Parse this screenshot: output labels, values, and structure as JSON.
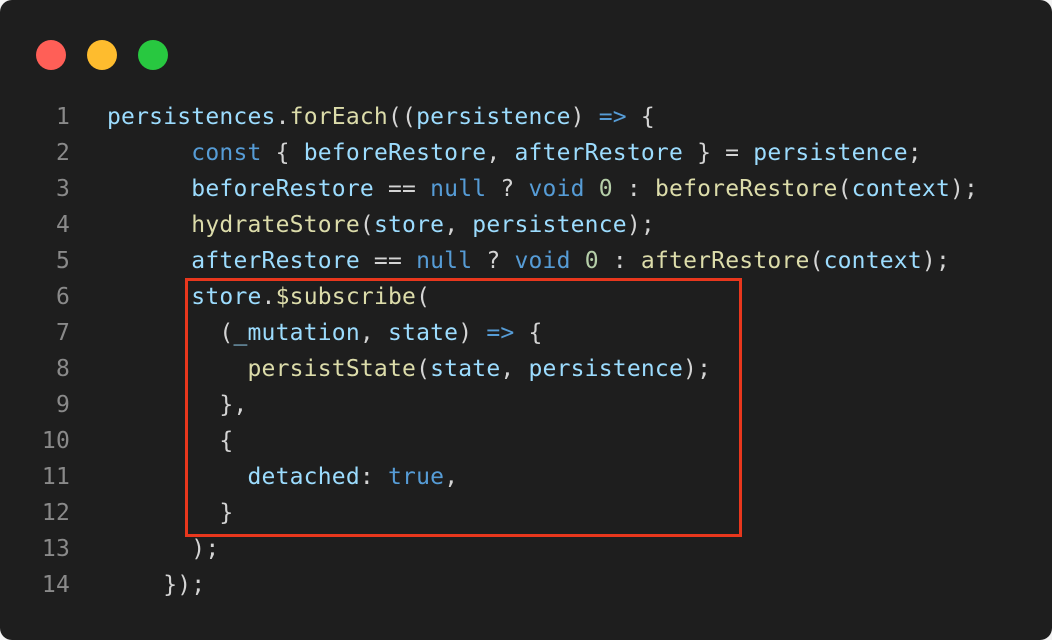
{
  "window": {
    "controls": [
      {
        "name": "close",
        "color": "#ff5f57"
      },
      {
        "name": "minimize",
        "color": "#febc2e"
      },
      {
        "name": "zoom",
        "color": "#28c840"
      }
    ]
  },
  "colors": {
    "background": "#1e1e1e",
    "line_number": "#8a8a8a",
    "highlight_border": "#e8371d",
    "variable": "#9cdcfe",
    "keyword": "#569cd6",
    "function": "#dcdcaa",
    "number": "#b5cea8",
    "punctuation": "#d4d4d4"
  },
  "highlight": {
    "from_line": 6,
    "to_line": 12
  },
  "lines": [
    {
      "number": "1",
      "tokens": [
        {
          "t": "persistences",
          "c": "variable"
        },
        {
          "t": ".",
          "c": "punctuation"
        },
        {
          "t": "forEach",
          "c": "function"
        },
        {
          "t": "((",
          "c": "punctuation"
        },
        {
          "t": "persistence",
          "c": "variable"
        },
        {
          "t": ") ",
          "c": "punctuation"
        },
        {
          "t": "=>",
          "c": "keyword"
        },
        {
          "t": " {",
          "c": "punctuation"
        }
      ]
    },
    {
      "number": "2",
      "tokens": [
        {
          "t": "      ",
          "c": "punctuation"
        },
        {
          "t": "const",
          "c": "keyword"
        },
        {
          "t": " { ",
          "c": "punctuation"
        },
        {
          "t": "beforeRestore",
          "c": "variable"
        },
        {
          "t": ", ",
          "c": "punctuation"
        },
        {
          "t": "afterRestore",
          "c": "variable"
        },
        {
          "t": " } = ",
          "c": "punctuation"
        },
        {
          "t": "persistence",
          "c": "variable"
        },
        {
          "t": ";",
          "c": "punctuation"
        }
      ]
    },
    {
      "number": "3",
      "tokens": [
        {
          "t": "      ",
          "c": "punctuation"
        },
        {
          "t": "beforeRestore",
          "c": "variable"
        },
        {
          "t": " == ",
          "c": "punctuation"
        },
        {
          "t": "null",
          "c": "keyword"
        },
        {
          "t": " ? ",
          "c": "punctuation"
        },
        {
          "t": "void",
          "c": "keyword"
        },
        {
          "t": " ",
          "c": "punctuation"
        },
        {
          "t": "0",
          "c": "number"
        },
        {
          "t": " : ",
          "c": "punctuation"
        },
        {
          "t": "beforeRestore",
          "c": "function"
        },
        {
          "t": "(",
          "c": "punctuation"
        },
        {
          "t": "context",
          "c": "variable"
        },
        {
          "t": ");",
          "c": "punctuation"
        }
      ]
    },
    {
      "number": "4",
      "tokens": [
        {
          "t": "      ",
          "c": "punctuation"
        },
        {
          "t": "hydrateStore",
          "c": "function"
        },
        {
          "t": "(",
          "c": "punctuation"
        },
        {
          "t": "store",
          "c": "variable"
        },
        {
          "t": ", ",
          "c": "punctuation"
        },
        {
          "t": "persistence",
          "c": "variable"
        },
        {
          "t": ");",
          "c": "punctuation"
        }
      ]
    },
    {
      "number": "5",
      "tokens": [
        {
          "t": "      ",
          "c": "punctuation"
        },
        {
          "t": "afterRestore",
          "c": "variable"
        },
        {
          "t": " == ",
          "c": "punctuation"
        },
        {
          "t": "null",
          "c": "keyword"
        },
        {
          "t": " ? ",
          "c": "punctuation"
        },
        {
          "t": "void",
          "c": "keyword"
        },
        {
          "t": " ",
          "c": "punctuation"
        },
        {
          "t": "0",
          "c": "number"
        },
        {
          "t": " : ",
          "c": "punctuation"
        },
        {
          "t": "afterRestore",
          "c": "function"
        },
        {
          "t": "(",
          "c": "punctuation"
        },
        {
          "t": "context",
          "c": "variable"
        },
        {
          "t": ");",
          "c": "punctuation"
        }
      ]
    },
    {
      "number": "6",
      "tokens": [
        {
          "t": "      ",
          "c": "punctuation"
        },
        {
          "t": "store",
          "c": "variable"
        },
        {
          "t": ".",
          "c": "punctuation"
        },
        {
          "t": "$subscribe",
          "c": "function"
        },
        {
          "t": "(",
          "c": "punctuation"
        }
      ]
    },
    {
      "number": "7",
      "tokens": [
        {
          "t": "        (",
          "c": "punctuation"
        },
        {
          "t": "_mutation",
          "c": "variable"
        },
        {
          "t": ", ",
          "c": "punctuation"
        },
        {
          "t": "state",
          "c": "variable"
        },
        {
          "t": ") ",
          "c": "punctuation"
        },
        {
          "t": "=>",
          "c": "keyword"
        },
        {
          "t": " {",
          "c": "punctuation"
        }
      ]
    },
    {
      "number": "8",
      "tokens": [
        {
          "t": "          ",
          "c": "punctuation"
        },
        {
          "t": "persistState",
          "c": "function"
        },
        {
          "t": "(",
          "c": "punctuation"
        },
        {
          "t": "state",
          "c": "variable"
        },
        {
          "t": ", ",
          "c": "punctuation"
        },
        {
          "t": "persistence",
          "c": "variable"
        },
        {
          "t": ");",
          "c": "punctuation"
        }
      ]
    },
    {
      "number": "9",
      "tokens": [
        {
          "t": "        },",
          "c": "punctuation"
        }
      ]
    },
    {
      "number": "10",
      "tokens": [
        {
          "t": "        {",
          "c": "punctuation"
        }
      ]
    },
    {
      "number": "11",
      "tokens": [
        {
          "t": "          ",
          "c": "punctuation"
        },
        {
          "t": "detached",
          "c": "variable"
        },
        {
          "t": ": ",
          "c": "punctuation"
        },
        {
          "t": "true",
          "c": "keyword"
        },
        {
          "t": ",",
          "c": "punctuation"
        }
      ]
    },
    {
      "number": "12",
      "tokens": [
        {
          "t": "        }",
          "c": "punctuation"
        }
      ]
    },
    {
      "number": "13",
      "tokens": [
        {
          "t": "      );",
          "c": "punctuation"
        }
      ]
    },
    {
      "number": "14",
      "tokens": [
        {
          "t": "    });",
          "c": "punctuation"
        }
      ]
    }
  ]
}
